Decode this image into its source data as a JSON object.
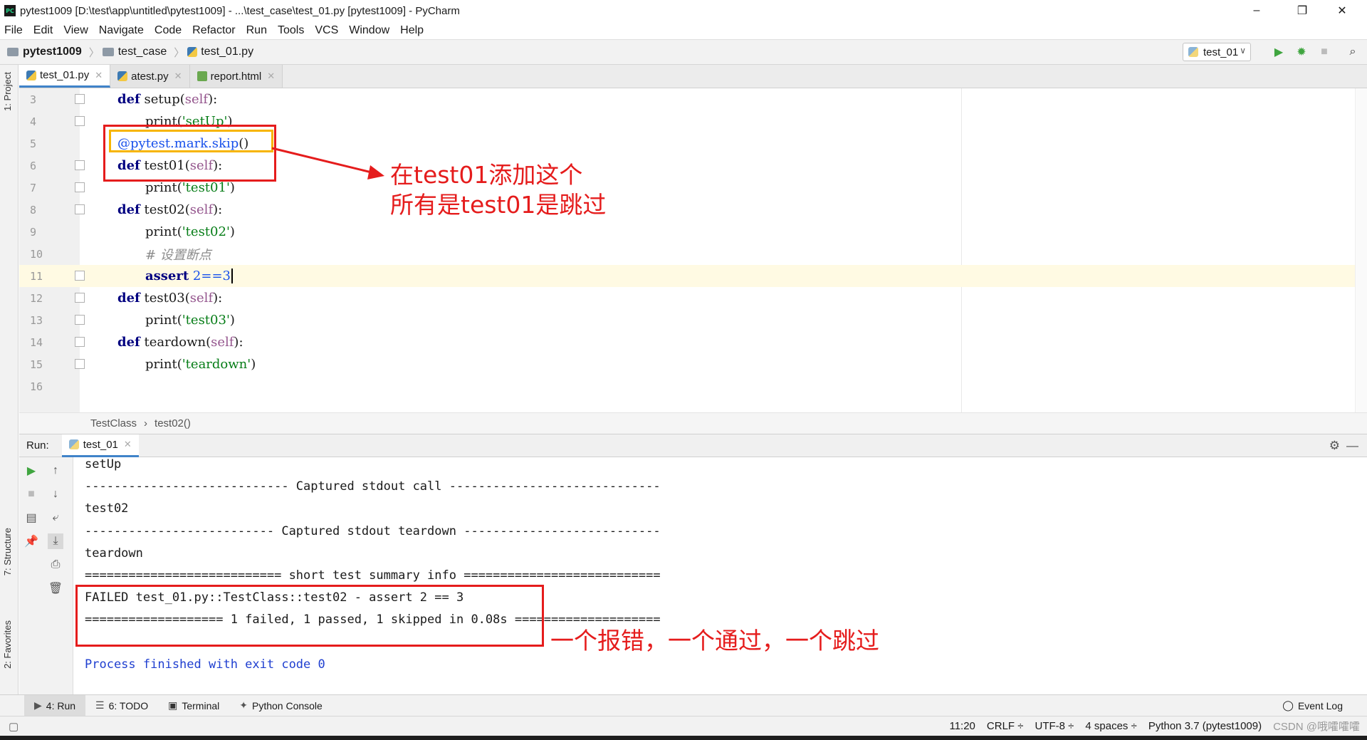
{
  "window": {
    "title": "pytest1009 [D:\\test\\app\\untitled\\pytest1009] - ...\\test_case\\test_01.py [pytest1009] - PyCharm",
    "app_icon_text": "PC",
    "minimize": "–",
    "restore": "❐",
    "close": "✕"
  },
  "menu": [
    {
      "label": "File"
    },
    {
      "label": "Edit"
    },
    {
      "label": "View"
    },
    {
      "label": "Navigate"
    },
    {
      "label": "Code"
    },
    {
      "label": "Refactor"
    },
    {
      "label": "Run"
    },
    {
      "label": "Tools"
    },
    {
      "label": "VCS"
    },
    {
      "label": "Window"
    },
    {
      "label": "Help"
    }
  ],
  "navbar": {
    "project": "pytest1009",
    "folder": "test_case",
    "file": "test_01.py",
    "run_config": "test_01"
  },
  "side_labels": {
    "project": "1: Project",
    "structure": "7: Structure",
    "favorites": "2: Favorites"
  },
  "editor_tabs": [
    {
      "label": "test_01.py"
    },
    {
      "label": "atest.py"
    },
    {
      "label": "report.html"
    }
  ],
  "editor": {
    "line_numbers": [
      "3",
      "4",
      "5",
      "6",
      "7",
      "8",
      "9",
      "10",
      "11",
      "12",
      "13",
      "14",
      "15",
      "16"
    ],
    "lines": {
      "l3": {
        "kw": "def",
        "name": " setup(",
        "self": "self",
        "end": "):"
      },
      "l4": {
        "fn": "print(",
        "str": "'setUp'",
        "end": ")"
      },
      "l5": {
        "dec": "@pytest.mark.skip",
        "end": "()"
      },
      "l6": {
        "kw": "def",
        "name": " test01(",
        "self": "self",
        "end": "):"
      },
      "l7": {
        "fn": "print(",
        "str": "'test01'",
        "end": ")"
      },
      "l8": {
        "kw": "def",
        "name": " test02(",
        "self": "self",
        "end": "):"
      },
      "l9": {
        "fn": "print(",
        "str": "'test02'",
        "end": ")"
      },
      "l10": {
        "comment": "# 设置断点"
      },
      "l11": {
        "kw": "assert",
        "num": " 2==3"
      },
      "l12": {
        "kw": "def",
        "name": " test03(",
        "self": "self",
        "end": "):"
      },
      "l13": {
        "fn": "print(",
        "str": "'test03'",
        "end": ")"
      },
      "l14": {
        "kw": "def",
        "name": " teardown(",
        "self": "self",
        "end": "):"
      },
      "l15": {
        "fn": "print(",
        "str": "'teardown'",
        "end": ")"
      }
    }
  },
  "breadcrumb": {
    "class": "TestClass",
    "sep": "›",
    "method": "test02()"
  },
  "run": {
    "label": "Run:",
    "tab": "test_01",
    "console": [
      "setUp",
      "---------------------------- Captured stdout call -----------------------------",
      "test02",
      "-------------------------- Captured stdout teardown ---------------------------",
      "teardown",
      "=========================== short test summary info ===========================",
      "FAILED test_01.py::TestClass::test02 - assert 2 == 3",
      "=================== 1 failed, 1 passed, 1 skipped in 0.08s ====================",
      "",
      "Process finished with exit code 0"
    ]
  },
  "annotations": {
    "top_line1": "在test01添加这个",
    "top_line2": "所有是test01是跳过",
    "bottom": "一个报错，一个通过，一个跳过"
  },
  "bottom_tabs": [
    {
      "label": "4: Run"
    },
    {
      "label": "6: TODO"
    },
    {
      "label": "Terminal"
    },
    {
      "label": "Python Console"
    }
  ],
  "event_log": "Event Log",
  "status": {
    "position": "11:20",
    "line_sep": "CRLF ÷",
    "encoding": "UTF-8 ÷",
    "indent": "4 spaces ÷",
    "interpreter": "Python 3.7 (pytest1009)",
    "watermark": "CSDN @哦嚯嚯嚯"
  },
  "colors": {
    "annotation": "#e51c1c",
    "decorator_box": "#f7b500",
    "keyword": "#000080",
    "string": "#067d17",
    "run_green": "#3fa53f"
  }
}
